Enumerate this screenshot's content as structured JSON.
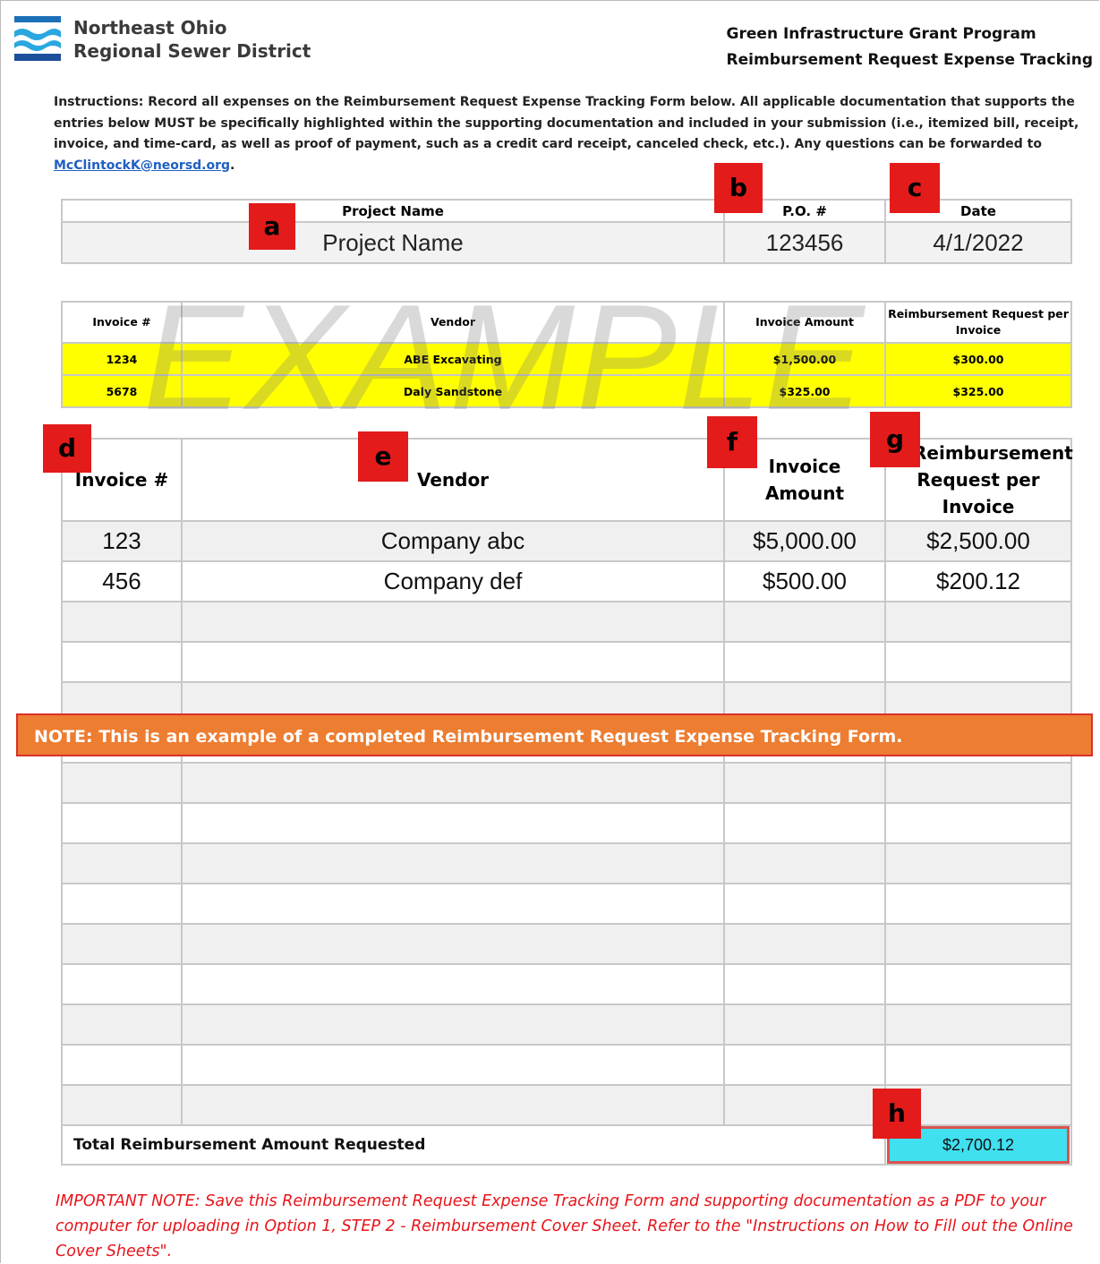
{
  "header": {
    "org_line1": "Northeast Ohio",
    "org_line2": "Regional Sewer District",
    "program_line1": "Green Infrastructure Grant Program",
    "program_line2": "Reimbursement Request Expense Tracking"
  },
  "instructions": {
    "text": "Instructions: Record all expenses on the Reimbursement Request Expense Tracking Form below.  All applicable documentation that supports the entries below MUST be specifically highlighted within the supporting documentation and included in your submission (i.e., itemized bill, receipt, invoice, and time-card, as well as proof of payment, such as a credit card receipt, canceled check, etc.). Any questions can be forwarded to ",
    "email": "McClintockK@neorsd.org",
    "end": "."
  },
  "project": {
    "headers": [
      "Project Name",
      "P.O. #",
      "Date"
    ],
    "values": [
      "Project Name",
      "123456",
      "4/1/2022"
    ]
  },
  "example": {
    "watermark": "EXAMPLE",
    "headers": [
      "Invoice #",
      "Vendor",
      "Invoice Amount",
      "Reimbursement Request per Invoice"
    ],
    "rows": [
      [
        "1234",
        "ABE Excavating",
        "$1,500.00",
        "$300.00"
      ],
      [
        "5678",
        "Daly Sandstone",
        "$325.00",
        "$325.00"
      ]
    ]
  },
  "form": {
    "headers": [
      "Invoice #",
      "Vendor",
      "Invoice Amount",
      "Reimbursement Request per Invoice"
    ],
    "rows": [
      [
        "123",
        "Company abc",
        "$5,000.00",
        "$2,500.00"
      ],
      [
        "456",
        "Company def",
        "$500.00",
        "$200.12"
      ]
    ],
    "total_label": "Total Reimbursement Amount Requested",
    "total_value": "$2,700.12"
  },
  "note_banner": "NOTE: This is an example of a completed Reimbursement Request Expense Tracking Form.",
  "markers": [
    "a",
    "b",
    "c",
    "d",
    "e",
    "f",
    "g",
    "h"
  ],
  "important_note": "IMPORTANT NOTE: Save this Reimbursement Request Expense Tracking Form and supporting documentation as a PDF to your computer for uploading in Option 1, STEP 2 - Reimbursement Cover Sheet. Refer to the \"Instructions on How to Fill out the Online Cover Sheets\".",
  "colors": {
    "highlight": "#ffff00",
    "banner": "#ed7d31",
    "marker": "#e31b1b",
    "total_box": "#40e0f0",
    "important_text": "#e8141a",
    "logo_blue": "#1b6fb8"
  }
}
